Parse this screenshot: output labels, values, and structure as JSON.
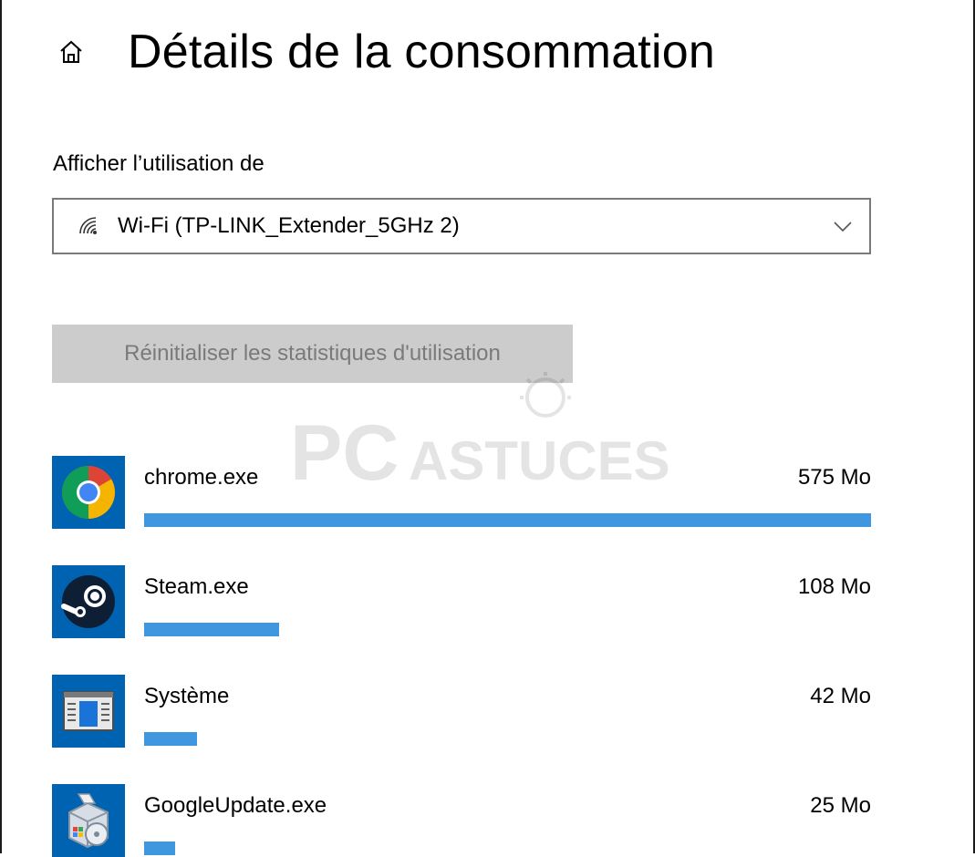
{
  "header": {
    "title": "Détails de la consommation",
    "home_icon": "home-icon"
  },
  "filter": {
    "label": "Afficher l’utilisation de",
    "selected_value": "Wi-Fi (TP-LINK_Extender_5GHz 2)",
    "icon": "wifi-icon"
  },
  "reset_button": {
    "label": "Réinitialiser les statistiques d'utilisation",
    "enabled": false
  },
  "apps": [
    {
      "name": "chrome.exe",
      "usage": "575 Mo",
      "usage_fraction": 1.0,
      "icon": "chrome-icon"
    },
    {
      "name": "Steam.exe",
      "usage": "108 Mo",
      "usage_fraction": 0.186,
      "icon": "steam-icon"
    },
    {
      "name": "Système",
      "usage": "42 Mo",
      "usage_fraction": 0.073,
      "icon": "system-window-icon"
    },
    {
      "name": "GoogleUpdate.exe",
      "usage": "25 Mo",
      "usage_fraction": 0.043,
      "icon": "google-update-icon"
    }
  ],
  "watermark": {
    "text_primary": "PC",
    "text_secondary": "ASTUCES"
  },
  "colors": {
    "usage_bar": "#3f97e0",
    "app_tile": "#0063b1",
    "reset_button_bg": "#cccccc",
    "reset_button_text": "#7a7a7a"
  }
}
